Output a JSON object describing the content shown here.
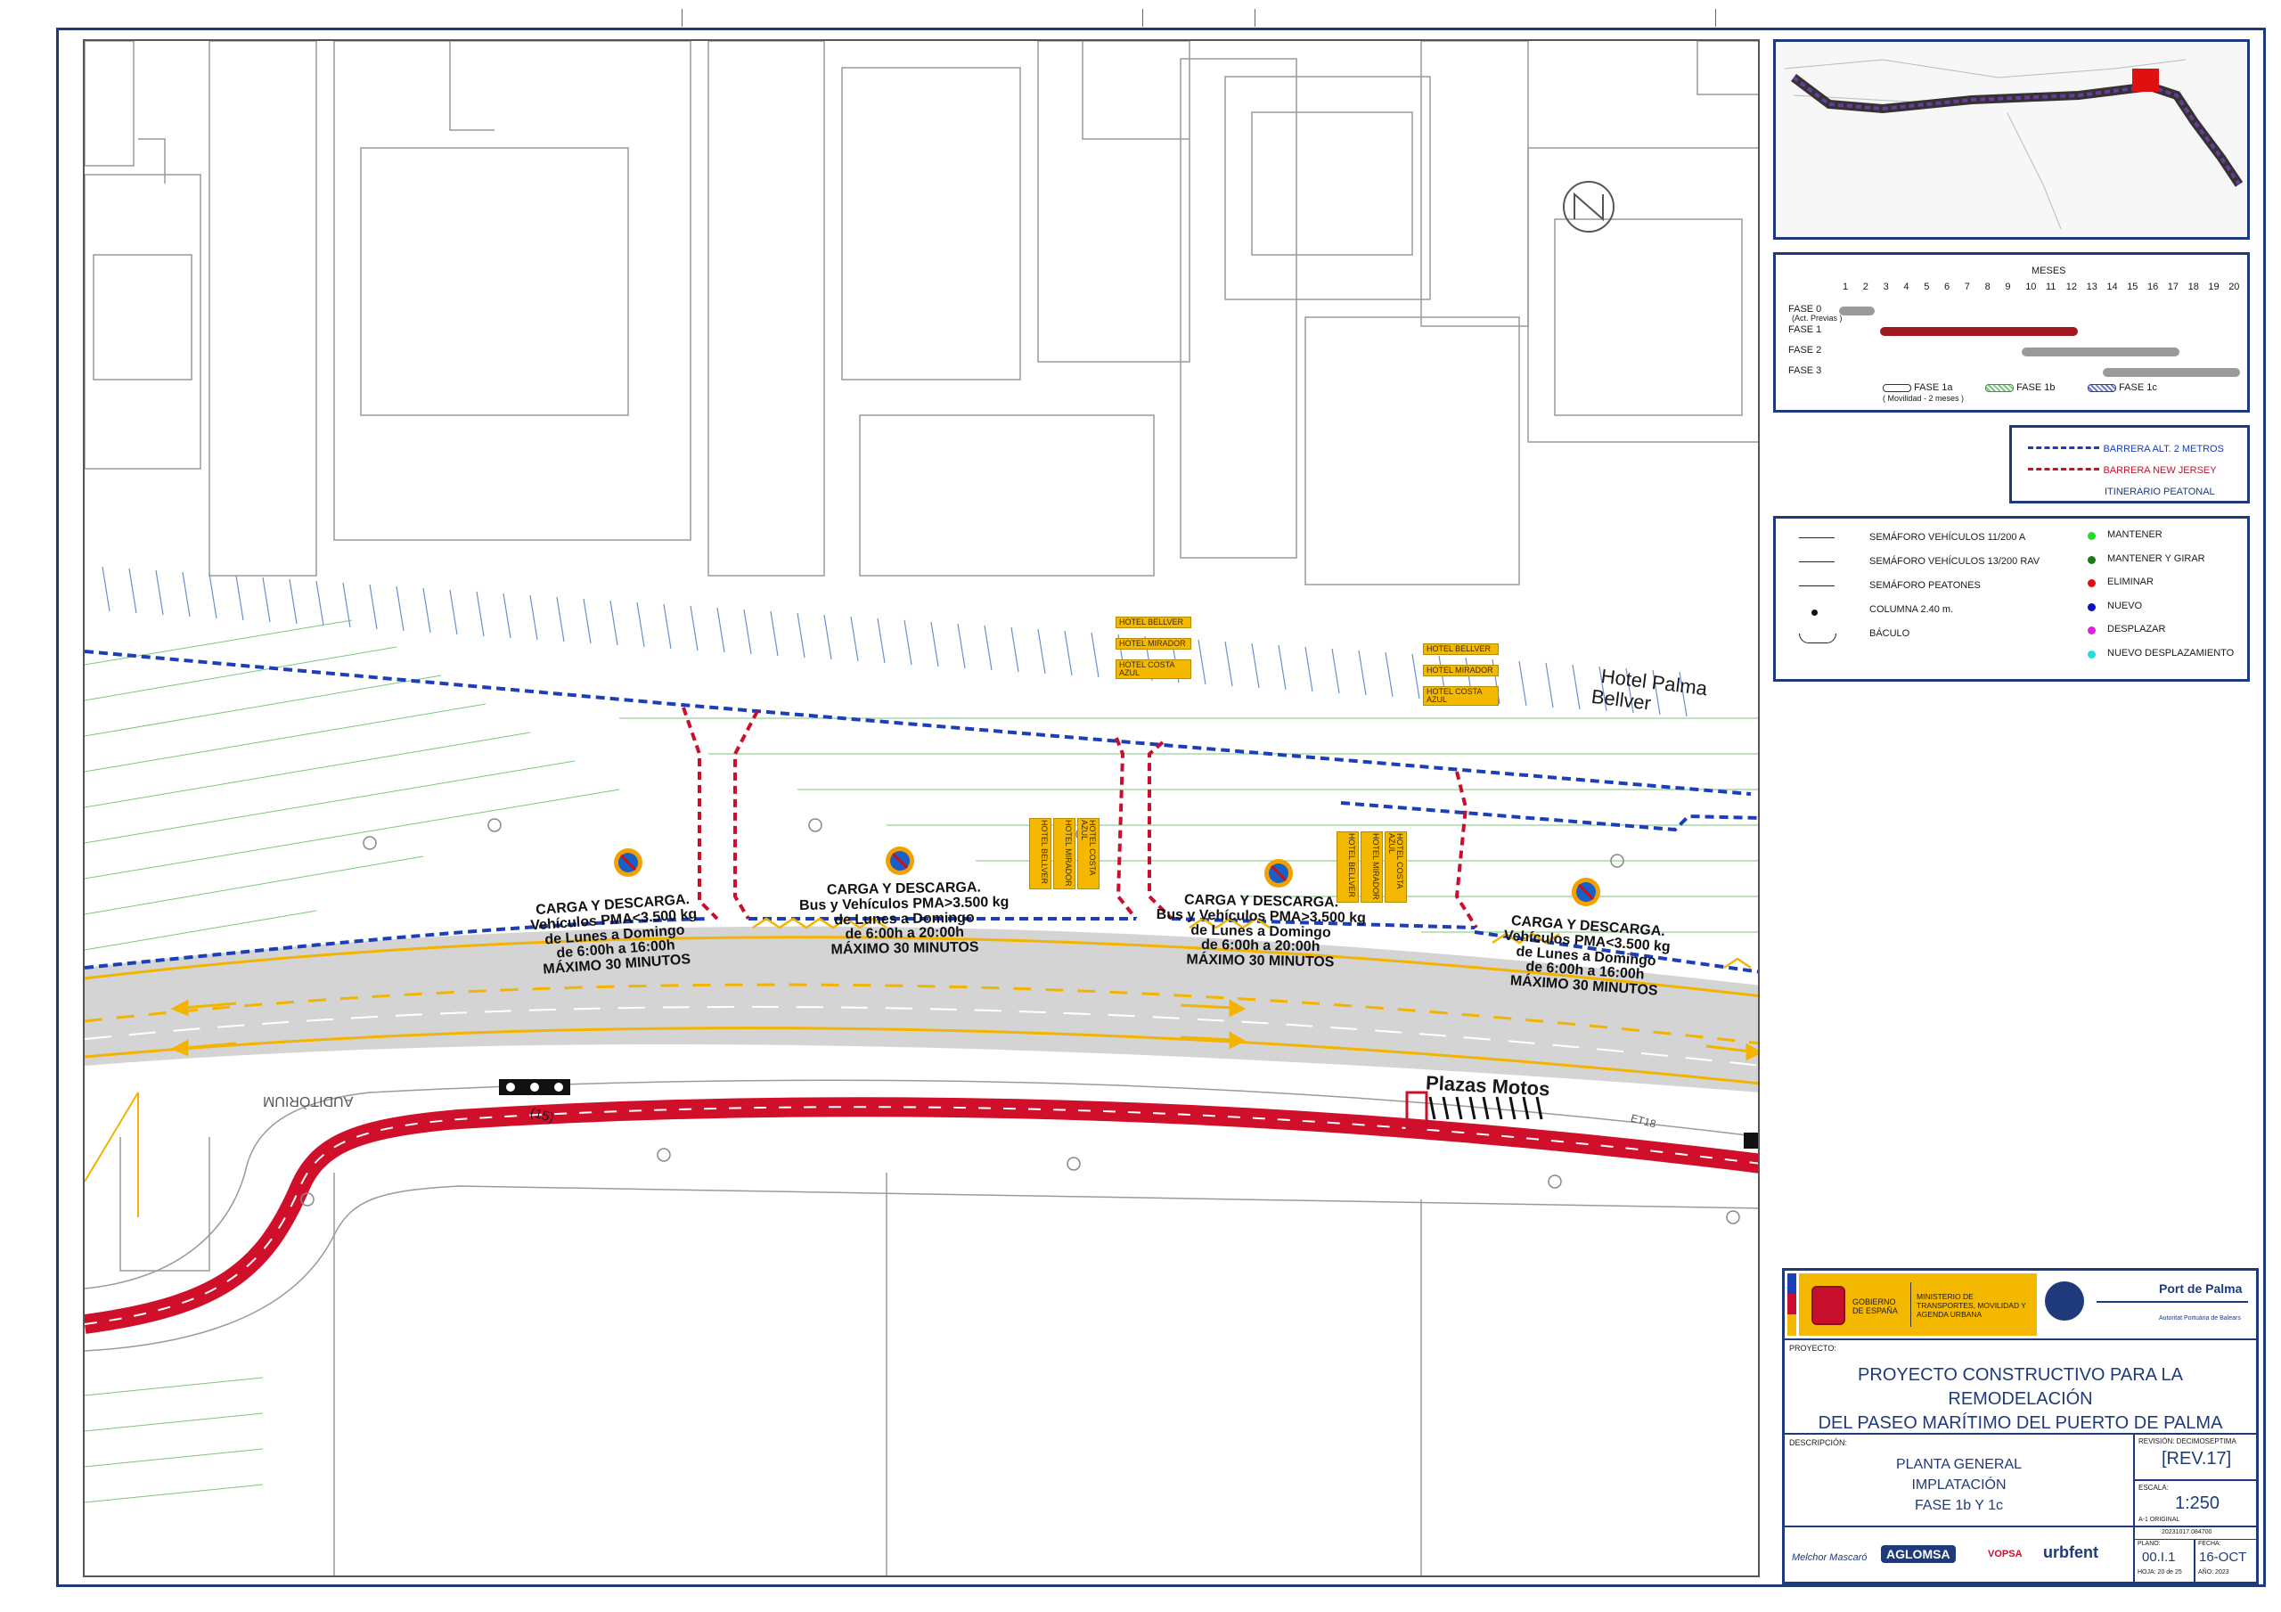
{
  "map": {
    "hotel_label_1": "Hotel Palma",
    "hotel_label_2": "Bellver",
    "plazas_motos": "Plazas Motos",
    "auditorium": "AUDITÒRIUM",
    "marker_15": "(15)",
    "marker_et": "ET18",
    "carga_zones": [
      {
        "line1": "CARGA Y DESCARGA.",
        "line2": "Vehículos PMA<3.500 kg",
        "line3": "de Lunes a Domingo",
        "line4": "de 6:00h a 16:00h",
        "line5": "MÁXIMO 30 MINUTOS"
      },
      {
        "line1": "CARGA Y DESCARGA.",
        "line2": "Bus y Vehículos PMA>3.500 kg",
        "line3": "de Lunes a Domingo",
        "line4": "de 6:00h a 20:00h",
        "line5": "MÁXIMO 30 MINUTOS"
      },
      {
        "line1": "CARGA Y DESCARGA.",
        "line2": "Bus y Vehículos PMA>3.500 kg",
        "line3": "de Lunes a Domingo",
        "line4": "de 6:00h a 20:00h",
        "line5": "MÁXIMO 30 MINUTOS"
      },
      {
        "line1": "CARGA Y DESCARGA.",
        "line2": "Vehículos PMA<3.500 kg",
        "line3": "de Lunes a Domingo",
        "line4": "de 6:00h a 16:00h",
        "line5": "MÁXIMO 30 MINUTOS"
      }
    ],
    "hotel_signs": [
      "HOTEL BELLVER",
      "HOTEL MIRADOR",
      "HOTEL COSTA AZUL"
    ],
    "colors": {
      "blue_barrier": "#1a3fb8",
      "red_barrier": "#c8102e",
      "bike_lane": "#d0102a",
      "yellow_line": "#f2b400",
      "road": "#d4d4d4",
      "sign": "#f5b800"
    }
  },
  "schedule": {
    "title": "MESES",
    "months": [
      "1",
      "2",
      "3",
      "4",
      "5",
      "6",
      "7",
      "8",
      "9",
      "10",
      "11",
      "12",
      "13",
      "14",
      "15",
      "16",
      "17",
      "18",
      "19",
      "20"
    ],
    "phases": [
      {
        "label": "FASE 0",
        "sub": "(Act. Previas )",
        "start": 1,
        "end": 2,
        "color": "#9a9a9a"
      },
      {
        "label": "FASE 1",
        "sub": "",
        "start": 3,
        "end": 12,
        "color": "#a01820"
      },
      {
        "label": "FASE 2",
        "sub": "",
        "start": 10,
        "end": 17,
        "color": "#9a9a9a"
      },
      {
        "label": "FASE 3",
        "sub": "",
        "start": 14,
        "end": 20,
        "color": "#9a9a9a"
      }
    ],
    "legend": [
      {
        "label": "FASE 1a",
        "sub": "( Movilidad - 2 meses )"
      },
      {
        "label": "FASE 1b",
        "sub": ""
      },
      {
        "label": "FASE 1c",
        "sub": ""
      }
    ]
  },
  "barrier_legend": [
    {
      "label": "BARRERA ALT. 2 METROS",
      "color": "#1a3fb8"
    },
    {
      "label": "BARRERA NEW JERSEY",
      "color": "#c8102e"
    },
    {
      "label": "ITINERARIO  PEATONAL",
      "color": ""
    }
  ],
  "symbols": {
    "left": [
      {
        "label": "SEMÁFORO VEHÍCULOS 11/200 A",
        "icon": "open-triangle-signal-icon"
      },
      {
        "label": "SEMÁFORO VEHÍCULOS 13/200 RAV",
        "icon": "filled-triangle-signal-icon"
      },
      {
        "label": "SEMÁFORO PEATONES",
        "icon": "square-signal-icon"
      },
      {
        "label": "COLUMNA 2.40 m.",
        "icon": "dot-icon"
      },
      {
        "label": "BÁCULO",
        "icon": "arc-pole-icon"
      }
    ],
    "right": [
      {
        "label": "MANTENER",
        "color": "#22dd22"
      },
      {
        "label": "MANTENER Y GIRAR",
        "color": "#1a7a1a"
      },
      {
        "label": "ELIMINAR",
        "color": "#e01010"
      },
      {
        "label": "NUEVO",
        "color": "#1010c0"
      },
      {
        "label": "DESPLAZAR",
        "color": "#e020e0"
      },
      {
        "label": "NUEVO DESPLAZAMIENTO",
        "color": "#22dddd"
      }
    ]
  },
  "title_block": {
    "gov1": "GOBIERNO DE ESPAÑA",
    "gov2": "MINISTERIO DE TRANSPORTES, MOVILIDAD Y AGENDA URBANA",
    "port": "Port de Palma",
    "port_sub": "Autoritat Portuària de Balears",
    "proyecto_label": "PROYECTO:",
    "proyecto_line1": "PROYECTO CONSTRUCTIVO PARA LA REMODELACIÓN",
    "proyecto_line2": "DEL PASEO MARÍTIMO DEL PUERTO DE PALMA",
    "descripcion_label": "DESCRIPCIÓN:",
    "desc1": "PLANTA GENERAL",
    "desc2": "IMPLATACIÓN",
    "desc3": "FASE 1b Y 1c",
    "revision_label": "REVISIÓN: DECIMOSEPTIMA",
    "revision": "[REV.17]",
    "escala_label": "ESCALA:",
    "escala": "1:250",
    "escala_note": "A-1 ORIGINAL",
    "code": "20231017.084700",
    "plano_label": "PLANO:",
    "plano": "00.I.1",
    "hoja": "HOJA: 20 de 25",
    "fecha_label": "FECHA:",
    "fecha": "16-OCT",
    "anio": "AÑO: 2023",
    "logos": [
      "Melchor Mascaró",
      "AGLOMSA",
      "VOPSA",
      "urbfent"
    ]
  }
}
